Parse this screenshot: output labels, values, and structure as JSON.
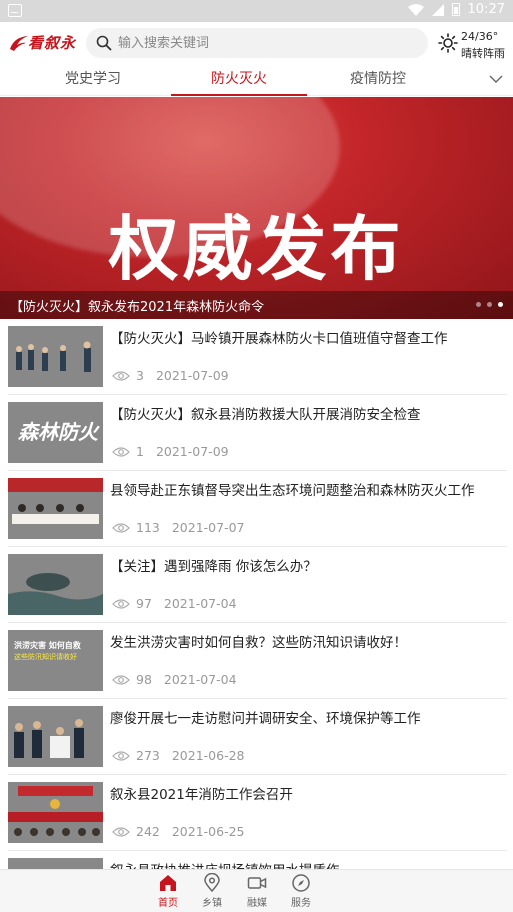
{
  "status_bar": {
    "time": "10:27"
  },
  "header": {
    "logo_text": "看叙永",
    "search_placeholder": "输入搜索关键词",
    "weather_temp": "24/36°",
    "weather_condition": "晴转阵雨",
    "weather_icon": "sun-icon"
  },
  "tabs": [
    {
      "label": "党史学习",
      "active": false
    },
    {
      "label": "防火灭火",
      "active": true
    },
    {
      "label": "疫情防控",
      "active": false
    }
  ],
  "banner": {
    "headline": "权威发布",
    "caption": "【防火灭火】叙永发布2021年森林防火命令",
    "slide_count": 3,
    "current_slide": 3
  },
  "news": [
    {
      "title": "【防火灭火】马岭镇开展森林防火卡口值班值守督查工作",
      "views": "3",
      "date": "2021-07-09"
    },
    {
      "title": "【防火灭火】叙永县消防救援大队开展消防安全检查",
      "views": "1",
      "date": "2021-07-09",
      "thumb_text": "森林防火"
    },
    {
      "title": "县领导赴正东镇督导突出生态环境问题整治和森林防灭火工作",
      "views": "113",
      "date": "2021-07-07"
    },
    {
      "title": "【关注】遇到强降雨 你该怎么办？",
      "views": "97",
      "date": "2021-07-04"
    },
    {
      "title": "发生洪涝灾害时如何自救？这些防汛知识请收好！",
      "views": "98",
      "date": "2021-07-04",
      "thumb_text": "洪涝灾害 如何自救",
      "thumb_text2": "这些防汛知识请收好"
    },
    {
      "title": "廖俊开展七一走访慰问并调研安全、环境保护等工作",
      "views": "273",
      "date": "2021-06-28"
    },
    {
      "title": "叙永县2021年消防工作会召开",
      "views": "242",
      "date": "2021-06-25"
    },
    {
      "title": "叙永县政协推进庙坝场镇饮用水提质作",
      "views": "",
      "date": ""
    }
  ],
  "bottom_nav": [
    {
      "label": "首页",
      "icon": "home-icon",
      "active": true
    },
    {
      "label": "乡镇",
      "icon": "location-pin-icon",
      "active": false
    },
    {
      "label": "融媒",
      "icon": "video-camera-icon",
      "active": false
    },
    {
      "label": "服务",
      "icon": "compass-icon",
      "active": false
    }
  ],
  "colors": {
    "brand_red": "#c4161c"
  }
}
